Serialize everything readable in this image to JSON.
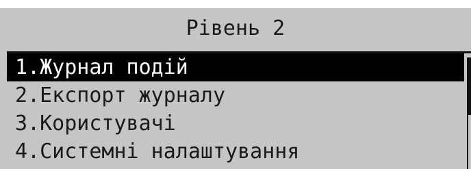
{
  "header": {
    "title": "Рівень 2"
  },
  "menu": {
    "selected_index": 0,
    "items": [
      {
        "label": "1.Журнал подій"
      },
      {
        "label": "2.Експорт журналу"
      },
      {
        "label": "3.Користувачі"
      },
      {
        "label": "4.Системні налаштування"
      }
    ]
  },
  "colors": {
    "screen_background": "#c5c5c5",
    "text": "#1a1a1a",
    "highlight_background": "#000000",
    "highlight_text": "#ffffff"
  }
}
